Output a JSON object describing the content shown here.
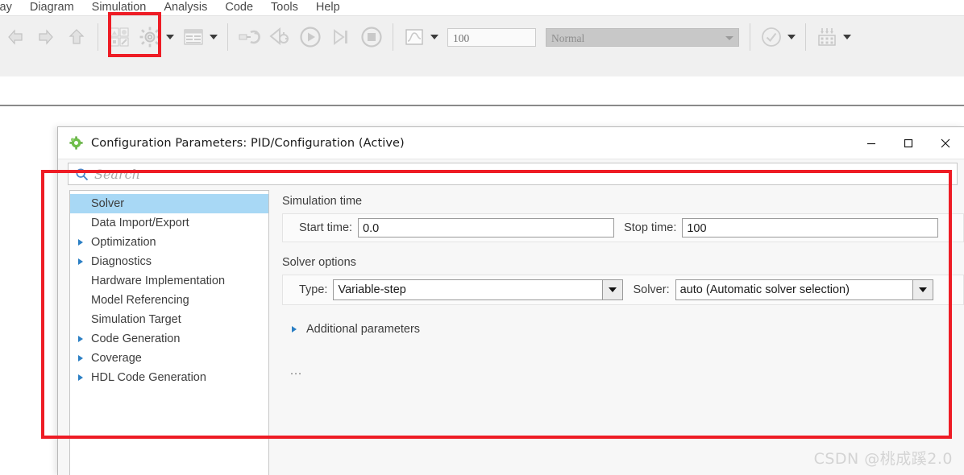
{
  "menubar": {
    "items": [
      "splay",
      "Diagram",
      "Simulation",
      "Analysis",
      "Code",
      "Tools",
      "Help"
    ]
  },
  "toolbar": {
    "back_icon": "back-arrow-icon",
    "forward_icon": "forward-arrow-icon",
    "up_icon": "up-arrow-icon",
    "library_icon": "library-browser-icon",
    "model_config_icon": "model-configuration-gear-icon",
    "model_explorer_icon": "model-explorer-icon",
    "update_icon": "update-model-icon",
    "fast_restart_icon": "fast-restart-icon",
    "run_icon": "run-icon",
    "step_forward_icon": "step-forward-icon",
    "stop_icon": "stop-icon",
    "scope_icon": "scope-icon",
    "stop_time_value": "100",
    "sim_mode_value": "Normal",
    "check_icon": "model-advisor-check-icon",
    "build_icon": "build-model-icon"
  },
  "dialog": {
    "title": "Configuration Parameters: PID/Configuration (Active)",
    "title_icon": "config-parameters-gear-icon",
    "minimize_label": "—",
    "maximize_label": "□",
    "close_label": "✕",
    "search": {
      "placeholder": "Search",
      "value": "",
      "icon": "search-icon"
    },
    "tree": {
      "items": [
        {
          "label": "Solver",
          "expandable": false,
          "selected": true
        },
        {
          "label": "Data Import/Export",
          "expandable": false,
          "selected": false
        },
        {
          "label": "Optimization",
          "expandable": true,
          "selected": false
        },
        {
          "label": "Diagnostics",
          "expandable": true,
          "selected": false
        },
        {
          "label": "Hardware Implementation",
          "expandable": false,
          "selected": false
        },
        {
          "label": "Model Referencing",
          "expandable": false,
          "selected": false
        },
        {
          "label": "Simulation Target",
          "expandable": false,
          "selected": false
        },
        {
          "label": "Code Generation",
          "expandable": true,
          "selected": false
        },
        {
          "label": "Coverage",
          "expandable": true,
          "selected": false
        },
        {
          "label": "HDL Code Generation",
          "expandable": true,
          "selected": false
        }
      ]
    },
    "solver_page": {
      "simulation_time_title": "Simulation time",
      "start_time_label": "Start time:",
      "start_time_value": "0.0",
      "stop_time_label": "Stop time:",
      "stop_time_value": "100",
      "solver_options_title": "Solver options",
      "type_label": "Type:",
      "type_value": "Variable-step",
      "solver_label": "Solver:",
      "solver_value": "auto (Automatic solver selection)",
      "additional_parameters_label": "Additional parameters",
      "overflow_text": "..."
    }
  },
  "annotations": {
    "gear_highlight": "red-highlight-box",
    "dialog_highlight": "red-highlight-box"
  },
  "watermark": "CSDN @桃成蹊2.0",
  "colors": {
    "accent_red": "#ee1c25",
    "selection_blue": "#a8d8f5",
    "tree_arrow_blue": "#2b7fc4"
  }
}
